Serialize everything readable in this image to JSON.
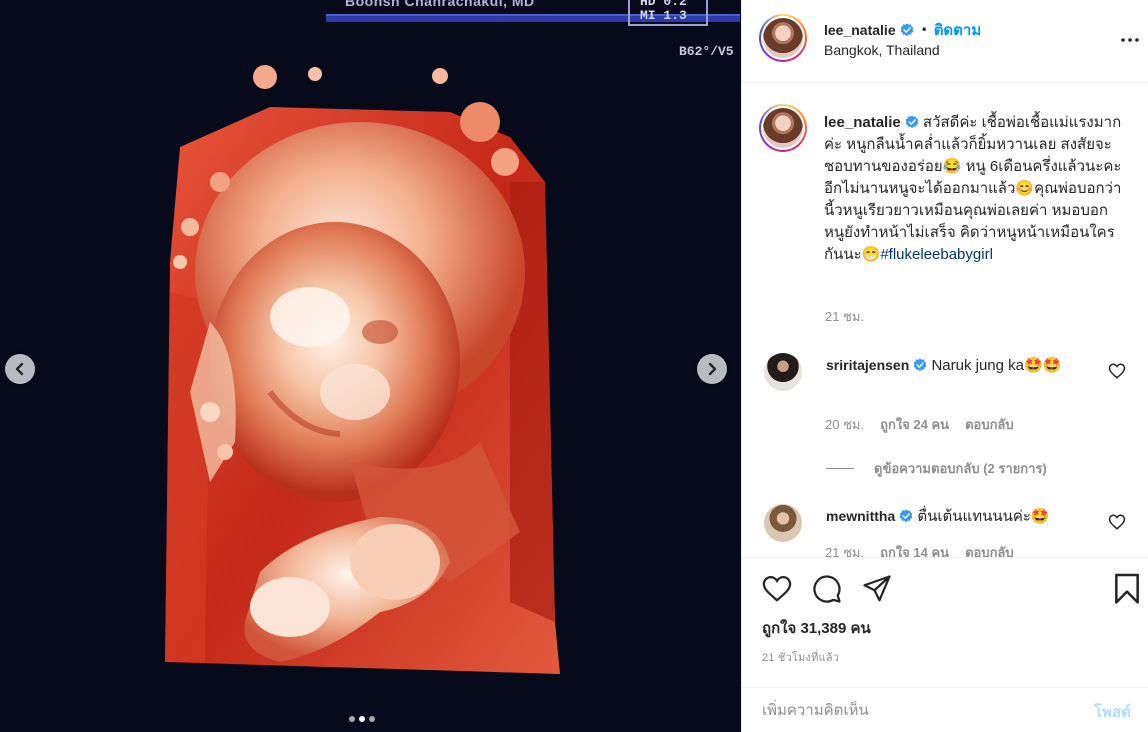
{
  "media": {
    "monitor": {
      "doctor_name": "Boonsn Chanrachakul, MD",
      "readout_line1": "HD 0.2",
      "readout_line2": "MI 1.3",
      "probe_label": "B62°/V5"
    },
    "nav": {
      "prev_icon": "chevron-left-icon",
      "next_icon": "chevron-right-icon"
    },
    "carousel": {
      "total": 3,
      "active_index": 1
    }
  },
  "post_header": {
    "username": "lee_natalie",
    "verified": true,
    "bullet": "•",
    "follow_label": "ติดตาม",
    "location": "Bangkok, Thailand"
  },
  "caption": {
    "username": "lee_natalie",
    "text": "สวัสดีค่ะ เชื้อพ่อเชื้อแม่แรงมากค่ะ หนูกลืนน้ำคล่ำแล้วก็ยิ้มหวานเลย สงสัยจะชอบทานของอร่อย😂 หนู 6เดือนครึ่งแล้วนะคะอีกไม่นานหนูจะได้ออกมาแล้ว😊คุณพ่อบอกว่านี้วหนูเรียวยาวเหมือนคุณพ่อเลยค่า หมอบอกหนูยังทำหน้าไม่เสร็จ คิดว่าหนูหน้าเหมือนใครกันนะ😁",
    "hashtag": "#flukeleebabygirl",
    "time": "21 ชม."
  },
  "comments": [
    {
      "username": "sriritajensen",
      "verified": true,
      "text": "Naruk jung ka🤩🤩",
      "time": "20 ชม.",
      "likes_label": "ถูกใจ 24 คน",
      "reply_label": "ตอบกลับ",
      "view_replies_label": "ดูข้อความตอบกลับ (2 รายการ)"
    },
    {
      "username": "mewnittha",
      "verified": true,
      "text": "ตื่นเต้นแทนนนค่ะ🤩",
      "time": "21 ชม.",
      "likes_label": "ถูกใจ 14 คน",
      "reply_label": "ตอบกลับ"
    }
  ],
  "actions": {
    "like_icon": "heart-icon",
    "comment_icon": "comment-icon",
    "share_icon": "share-icon",
    "save_icon": "bookmark-icon",
    "likes_text": "ถูกใจ 31,389 คน",
    "post_time": "21 ชั่วโมงที่แล้ว"
  },
  "add_comment": {
    "placeholder": "เพิ่มความคิดเห็น",
    "post_label": "โพสต์"
  },
  "colors": {
    "accent": "#0095f6",
    "hashtag": "#00376b",
    "muted": "#8e8e8e",
    "post_disabled": "#b2dffc",
    "media_background": "#060a1a"
  }
}
